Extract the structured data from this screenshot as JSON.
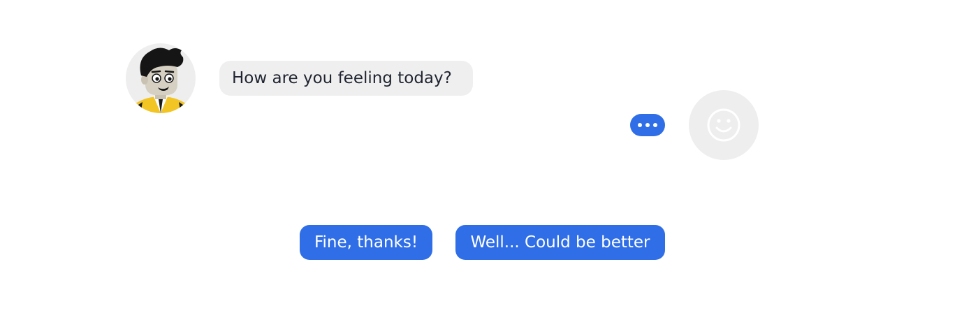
{
  "chat": {
    "bot_message": "How are you feeling today?",
    "typing_icon": "ellipsis-icon",
    "bot_avatar_icon": "cartoon-man-avatar",
    "user_avatar_icon": "smiley-face-icon"
  },
  "quick_replies": [
    {
      "label": "Fine, thanks!"
    },
    {
      "label": "Well... Could be better"
    }
  ],
  "colors": {
    "accent": "#2f6ee6",
    "bubble_bg": "#efefef",
    "avatar_bg": "#eeeeee",
    "text": "#1f2430",
    "jacket": "#f2c524"
  }
}
